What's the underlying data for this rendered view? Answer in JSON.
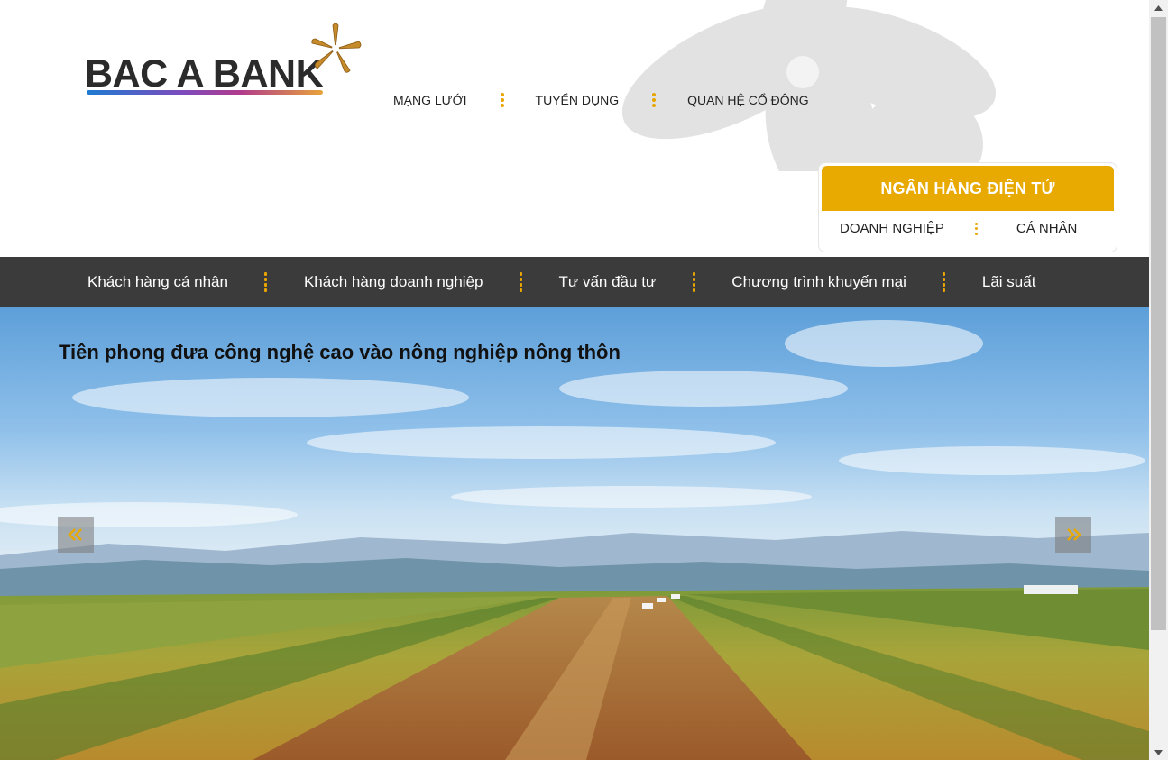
{
  "brand": {
    "name": "BAC A BANK",
    "accent_color": "#e8a900",
    "nav_bg_color": "#3b3b3b"
  },
  "top_links": [
    {
      "label": "MẠNG LƯỚI"
    },
    {
      "label": "TUYỂN DỤNG"
    },
    {
      "label": "QUAN HỆ CỔ ĐÔNG"
    }
  ],
  "ebanking": {
    "title": "NGÂN HÀNG ĐIỆN TỬ",
    "links": [
      {
        "label": "DOANH NGHIỆP"
      },
      {
        "label": "CÁ NHÂN"
      }
    ]
  },
  "main_nav": [
    {
      "label": "Khách hàng cá nhân"
    },
    {
      "label": "Khách hàng doanh nghiệp"
    },
    {
      "label": "Tư vấn đầu tư"
    },
    {
      "label": "Chương trình khuyến mại"
    },
    {
      "label": "Lãi suất"
    }
  ],
  "banner": {
    "caption": "Tiên phong đưa công nghệ cao vào nông nghiệp nông thôn",
    "prev_icon": "chevron-double-left-icon",
    "next_icon": "chevron-double-right-icon"
  }
}
